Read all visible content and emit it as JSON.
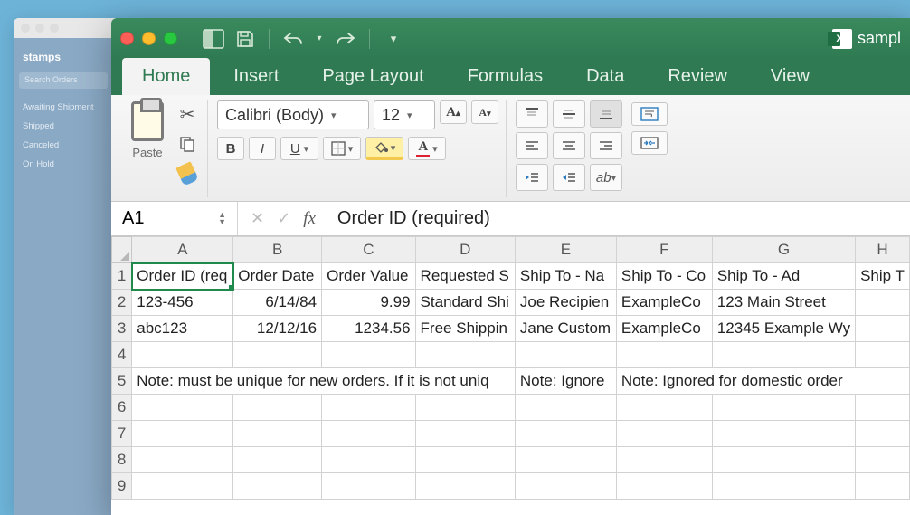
{
  "background": {
    "brand": "stamps",
    "search_placeholder": "Search Orders",
    "sidebar_items": [
      "Awaiting Shipment",
      "Shipped",
      "Canceled",
      "On Hold"
    ]
  },
  "titlebar": {
    "doc_name": "sampl"
  },
  "tabs": [
    "Home",
    "Insert",
    "Page Layout",
    "Formulas",
    "Data",
    "Review",
    "View"
  ],
  "active_tab": "Home",
  "ribbon": {
    "paste_label": "Paste",
    "font_name": "Calibri (Body)",
    "font_size": "12",
    "bold": "B",
    "italic": "I",
    "underline": "U"
  },
  "formula_bar": {
    "cell_ref": "A1",
    "content": "Order ID (required)"
  },
  "sheet": {
    "columns": [
      "A",
      "B",
      "C",
      "D",
      "E",
      "F",
      "G",
      "H"
    ],
    "row_numbers": [
      "1",
      "2",
      "3",
      "4",
      "5",
      "6",
      "7",
      "8",
      "9"
    ],
    "rows": [
      {
        "A": "Order ID (req",
        "B": "Order Date",
        "C": "Order Value",
        "D": "Requested S",
        "E": "Ship To - Na",
        "F": "Ship To - Co",
        "G": "Ship To - Ad",
        "H": "Ship T"
      },
      {
        "A": "123-456",
        "B": "6/14/84",
        "C": "9.99",
        "D": "Standard Shi",
        "E": "Joe Recipien",
        "F": "ExampleCo",
        "G": "123 Main Street",
        "H": ""
      },
      {
        "A": "abc123",
        "B": "12/12/16",
        "C": "1234.56",
        "D": "Free Shippin",
        "E": "Jane Custom",
        "F": "ExampleCo",
        "G": "12345 Example Wy",
        "H": ""
      },
      {
        "A": "",
        "B": "",
        "C": "",
        "D": "",
        "E": "",
        "F": "",
        "G": "",
        "H": ""
      },
      {
        "A": "Note: must be unique for new orders. If it is not uniq",
        "B": "",
        "C": "",
        "D": "",
        "E": "Note: Ignore",
        "F": "Note: Ignored for domestic order",
        "G": "",
        "H": ""
      },
      {
        "A": "",
        "B": "",
        "C": "",
        "D": "",
        "E": "",
        "F": "",
        "G": "",
        "H": ""
      },
      {
        "A": "",
        "B": "",
        "C": "",
        "D": "",
        "E": "",
        "F": "",
        "G": "",
        "H": ""
      },
      {
        "A": "",
        "B": "",
        "C": "",
        "D": "",
        "E": "",
        "F": "",
        "G": "",
        "H": ""
      },
      {
        "A": "",
        "B": "",
        "C": "",
        "D": "",
        "E": "",
        "F": "",
        "G": "",
        "H": ""
      }
    ],
    "selected": "A1"
  }
}
